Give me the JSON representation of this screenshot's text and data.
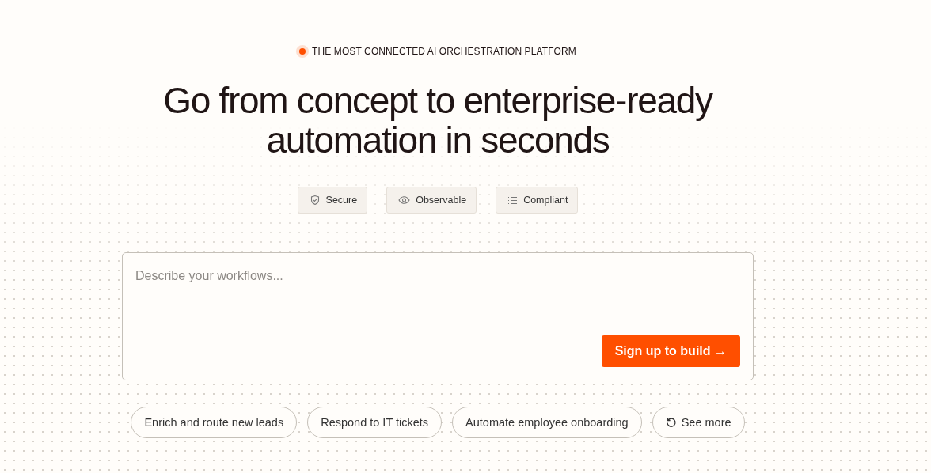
{
  "eyebrow": "THE MOST CONNECTED AI ORCHESTRATION PLATFORM",
  "headline": [
    "Go from concept to enterprise-ready",
    "automation in seconds"
  ],
  "features": [
    {
      "kind": "shield",
      "label": "Secure"
    },
    {
      "kind": "eye",
      "label": "Observable"
    },
    {
      "kind": "list",
      "label": "Compliant"
    }
  ],
  "prompt": {
    "placeholder": "Describe your workflows...",
    "button": "Sign up to build →"
  },
  "suggestions": [
    {
      "kind": "text",
      "label": "Enrich and route new leads"
    },
    {
      "kind": "text",
      "label": "Respond to IT tickets"
    },
    {
      "kind": "text",
      "label": "Automate employee onboarding"
    },
    {
      "kind": "more",
      "label": "See more"
    }
  ]
}
